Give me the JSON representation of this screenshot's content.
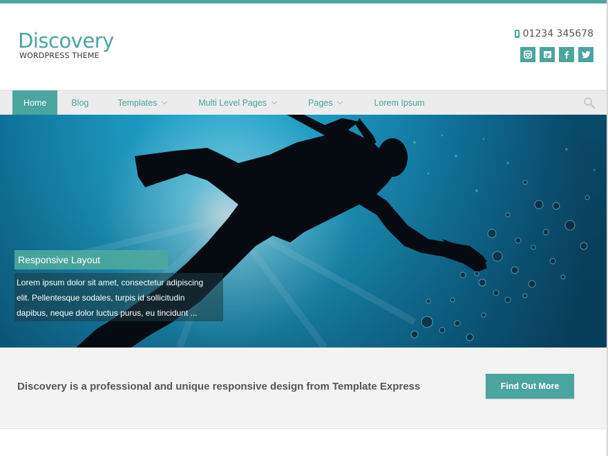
{
  "brand": {
    "name": "Discovery",
    "tagline": "WORDPRESS THEME",
    "accent_color": "#4aa59e"
  },
  "header": {
    "phone": "01234 345678",
    "phone_icon": "mobile-phone-icon",
    "socials": [
      {
        "name": "instagram",
        "icon": "instagram-icon"
      },
      {
        "name": "google-plus",
        "icon": "google-plus-icon"
      },
      {
        "name": "facebook",
        "icon": "facebook-icon"
      },
      {
        "name": "twitter",
        "icon": "twitter-icon"
      }
    ]
  },
  "nav": {
    "items": [
      {
        "label": "Home",
        "active": true,
        "has_dropdown": false
      },
      {
        "label": "Blog",
        "active": false,
        "has_dropdown": false
      },
      {
        "label": "Templates",
        "active": false,
        "has_dropdown": true
      },
      {
        "label": "Multi Level Pages",
        "active": false,
        "has_dropdown": true
      },
      {
        "label": "Pages",
        "active": false,
        "has_dropdown": true
      },
      {
        "label": "Lorem Ipsum",
        "active": false,
        "has_dropdown": false
      }
    ],
    "search_icon": "search-icon"
  },
  "slider": {
    "caption_title": "Responsive Layout",
    "caption_lines": [
      "Lorem ipsum dolor sit amet, consectetur adipiscing",
      "elit. Pellentesque sodales, turpis id sollicitudin",
      "dapibus, neque dolor luctus purus, eu tincidunt ..."
    ]
  },
  "cta": {
    "text": "Discovery is a professional and unique responsive design from Template Express",
    "button_label": "Find Out More"
  }
}
